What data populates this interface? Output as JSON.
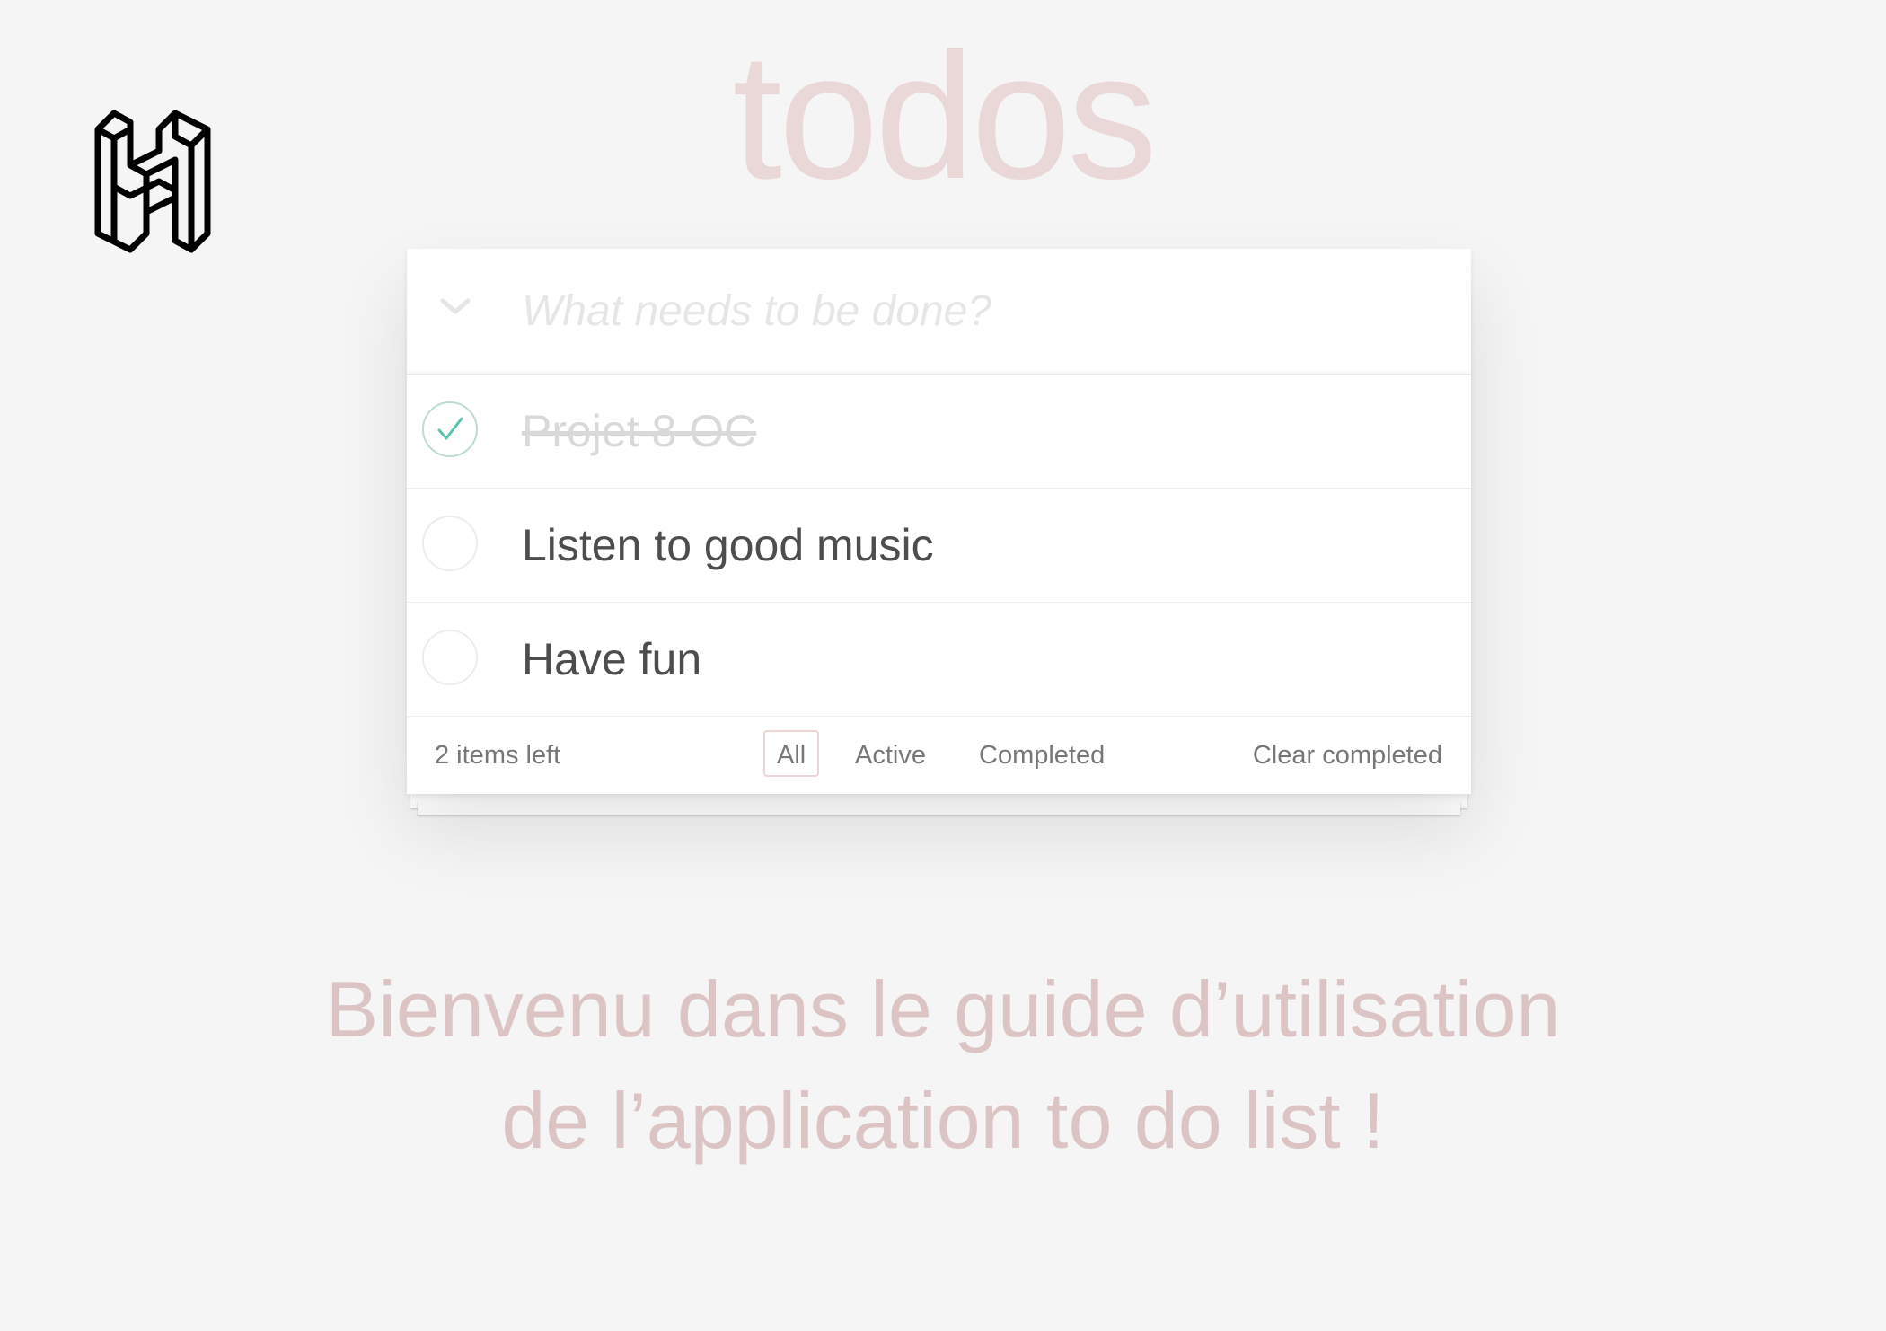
{
  "app": {
    "title": "todos"
  },
  "new_todo": {
    "placeholder": "What needs to be done?",
    "value": ""
  },
  "todos": [
    {
      "label": "Projet 8 OC",
      "completed": true
    },
    {
      "label": "Listen to good music",
      "completed": false
    },
    {
      "label": "Have fun",
      "completed": false
    }
  ],
  "footer": {
    "items_left": "2 items left",
    "filters": [
      {
        "label": "All",
        "selected": true
      },
      {
        "label": "Active",
        "selected": false
      },
      {
        "label": "Completed",
        "selected": false
      }
    ],
    "clear_completed": "Clear completed"
  },
  "welcome": {
    "line1": "Bienvenu dans le guide d’utilisation",
    "line2": "de l’application to do list !"
  },
  "icons": {
    "logo": "h-logo-icon",
    "toggle_all": "chevron-down-icon",
    "checked": "checkmark-icon"
  },
  "colors": {
    "background": "#f5f5f5",
    "title": "#efe2e2",
    "check": "#5dc2af",
    "welcome_text": "#dcc4c4",
    "selected_filter_border": "#efd5d5"
  }
}
